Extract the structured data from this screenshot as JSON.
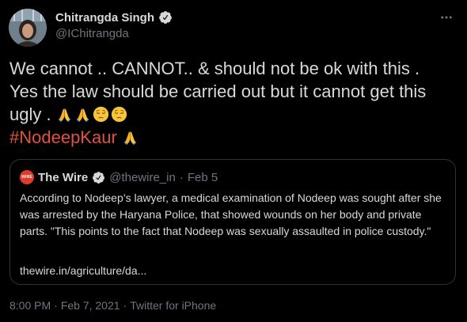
{
  "colors": {
    "background": "#000000",
    "text": "#d9d9d9",
    "secondary_text": "#6e767d",
    "hashtag": "#e0533d",
    "border": "#2f3336",
    "verified": "#d9d9d9",
    "wire_logo": "#e23a2b"
  },
  "icons": {
    "verified": "verified-badge-icon",
    "more": "more-options-icon",
    "folded_hands": "folded-hands-emoji",
    "pensive_face": "pensive-face-emoji"
  },
  "author": {
    "name": "Chitrangda Singh",
    "handle": "@IChitrangda"
  },
  "tweet": {
    "line1": "We cannot .. CANNOT.. & should not be ok with this .",
    "line2": "Yes the law should be carried out but it cannot get this",
    "line3": "ugly .",
    "hashtag": "#NodeepKaur"
  },
  "quote": {
    "logo_text": "WIRE",
    "name": "The Wire",
    "handle": "@thewire_in",
    "separator": "·",
    "date": "Feb 5",
    "body": "According to Nodeep’s lawyer, a medical examination of Nodeep was sought after she was arrested by the Haryana Police, that showed wounds on her body and private parts. \"This points to the fact that Nodeep was sexually assaulted in police custody.\"",
    "link": "thewire.in/agriculture/da..."
  },
  "footer": {
    "time": "8:00 PM",
    "separator": "·",
    "date": "Feb 7, 2021",
    "source": "Twitter for iPhone"
  }
}
